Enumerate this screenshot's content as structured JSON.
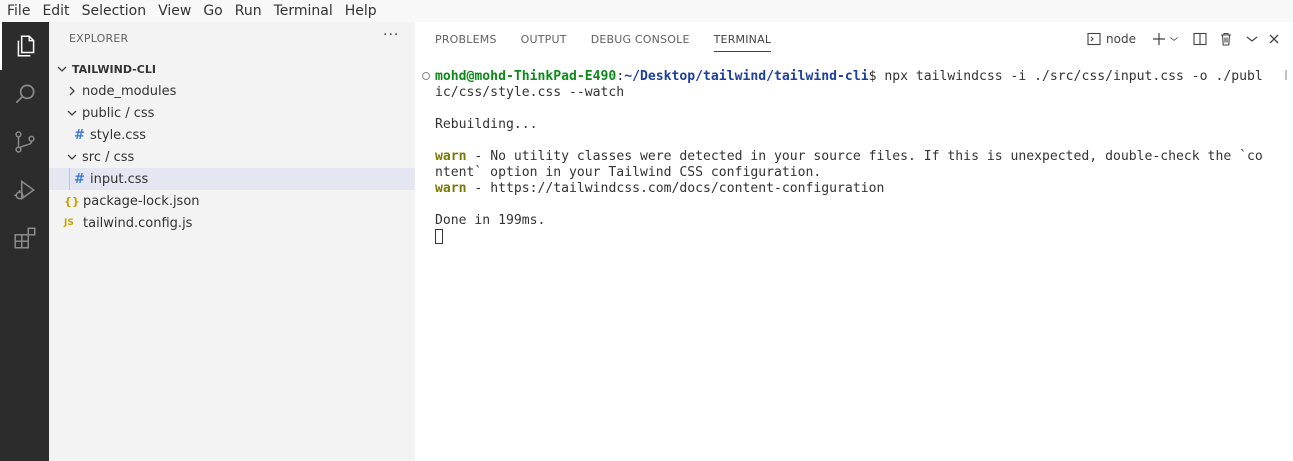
{
  "menu": [
    "File",
    "Edit",
    "Selection",
    "View",
    "Go",
    "Run",
    "Terminal",
    "Help"
  ],
  "activity_bar": [
    {
      "name": "explorer-icon",
      "active": true
    },
    {
      "name": "search-icon",
      "active": false
    },
    {
      "name": "source-control-icon",
      "active": false
    },
    {
      "name": "run-debug-icon",
      "active": false
    },
    {
      "name": "extensions-icon",
      "active": false
    }
  ],
  "explorer": {
    "header": "EXPLORER",
    "more": "···",
    "project": "TAILWIND-CLI",
    "items": [
      {
        "label": "node_modules",
        "kind": "folder-collapsed"
      },
      {
        "label": "public / css",
        "kind": "folder-expanded"
      },
      {
        "label": "style.css",
        "kind": "css"
      },
      {
        "label": "src / css",
        "kind": "folder-expanded"
      },
      {
        "label": "input.css",
        "kind": "css",
        "selected": true
      },
      {
        "label": "package-lock.json",
        "kind": "json"
      },
      {
        "label": "tailwind.config.js",
        "kind": "js"
      }
    ],
    "icons": {
      "css": "#",
      "json": "{}",
      "js": "JS"
    }
  },
  "panel": {
    "tabs": [
      "PROBLEMS",
      "OUTPUT",
      "DEBUG CONSOLE",
      "TERMINAL"
    ],
    "active_tab": "TERMINAL",
    "terminal_name": "node"
  },
  "terminal": {
    "user": "mohd@mohd-ThinkPad-E490",
    "colon": ":",
    "path": "~/Desktop/tailwind/tailwind-cli",
    "prompt_cmd": "$ npx tailwindcss -i ./src/css/input.css -o ./publ",
    "cmd_wrap": "ic/css/style.css --watch",
    "rebuilding": "Rebuilding...",
    "warn_label": "warn",
    "warn1_a": " - No utility classes were detected in your source files. If this is unexpected, double-check the `co",
    "warn1_b": "ntent` option in your Tailwind CSS configuration.",
    "warn2": " - https://tailwindcss.com/docs/content-configuration",
    "done": "Done in 199ms."
  },
  "colors": {
    "activity_bg": "#2c2c2c",
    "sidebar_bg": "#f3f3f3",
    "selected_bg": "#e4e6f1",
    "user_green": "#0d8a1a",
    "path_blue": "#1d3f9e",
    "warn_olive": "#7a7a00"
  }
}
